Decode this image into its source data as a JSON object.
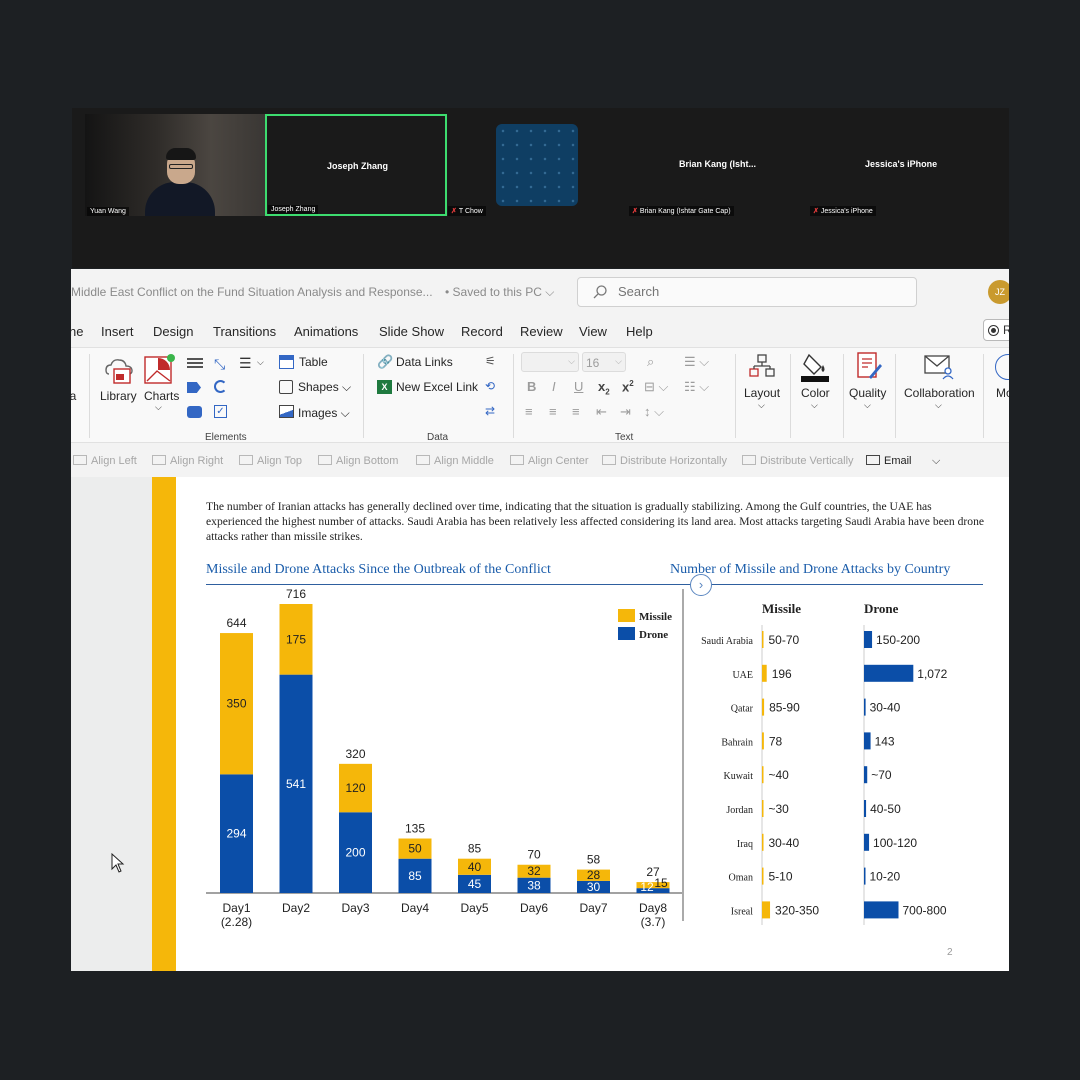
{
  "meeting": {
    "participants": [
      {
        "tile_name": "",
        "tag": "Yuan Wang",
        "muted": false
      },
      {
        "tile_name": "Joseph Zhang",
        "tag": "Joseph Zhang",
        "muted": false
      },
      {
        "tile_name": "",
        "tag": "T Chow",
        "muted": true
      },
      {
        "tile_name": "Brian Kang (Isht...",
        "tag": "Brian Kang (Ishtar Gate Cap)",
        "muted": true
      },
      {
        "tile_name": "Jessica's iPhone",
        "tag": "Jessica's iPhone",
        "muted": true
      }
    ]
  },
  "titlebar": {
    "doc_title": "e Middle East Conflict on the Fund Situation Analysis and Response...",
    "saved": "• Saved to this PC ⌵",
    "search_placeholder": "Search",
    "avatar_initials": "JZ"
  },
  "tabs": [
    "ne",
    "Insert",
    "Design",
    "Transitions",
    "Animations",
    "Slide Show",
    "Record",
    "Review",
    "View",
    "Help"
  ],
  "record_button": "R",
  "ribbon": {
    "cut_label": "la",
    "library": "Library",
    "charts": "Charts",
    "elements_group": "Elements",
    "table": "Table",
    "shapes": "Shapes ⌵",
    "images": "Images ⌵",
    "data_links": "Data Links",
    "new_excel_link": "New Excel Link",
    "data_group": "Data",
    "font_size": "16",
    "text_group": "Text",
    "layout": "Layout",
    "color": "Color",
    "quality": "Quality",
    "collaboration": "Collaboration",
    "more": "Mo"
  },
  "arrange_bar": [
    "Align Left",
    "Align Right",
    "Align Top",
    "Align Bottom",
    "Align Middle",
    "Align Center",
    "Distribute Horizontally",
    "Distribute Vertically"
  ],
  "email": "Email",
  "slide": {
    "intro": "The number of Iranian attacks has generally declined over time, indicating that the situation is gradually stabilizing. Among the Gulf countries, the UAE has experienced the highest number of attacks. Saudi Arabia has been relatively less affected considering its land area. Most attacks targeting Saudi Arabia have been drone attacks rather than missile strikes.",
    "left_title": "Missile and Drone Attacks Since the Outbreak of the Conflict",
    "right_title": "Number of Missile and Drone Attacks by Country",
    "nav_glyph": "›",
    "page_number": "2"
  },
  "colors": {
    "missile": "#f5b70a",
    "drone": "#0b4ea8",
    "accent": "#1a5caa"
  },
  "chart_data": [
    {
      "type": "bar",
      "stacked": true,
      "title": "Missile and Drone Attacks Since the Outbreak of the Conflict",
      "categories": [
        "Day1",
        "Day2",
        "Day3",
        "Day4",
        "Day5",
        "Day6",
        "Day7",
        "Day8"
      ],
      "category_sublabels": [
        "(2.28)",
        "",
        "",
        "",
        "",
        "",
        "",
        "(3.7)"
      ],
      "series": [
        {
          "name": "Drone",
          "values": [
            294,
            541,
            200,
            85,
            45,
            38,
            30,
            12
          ]
        },
        {
          "name": "Missile",
          "values": [
            350,
            175,
            120,
            50,
            40,
            32,
            28,
            15
          ]
        }
      ],
      "totals": [
        644,
        716,
        320,
        135,
        85,
        70,
        58,
        27
      ],
      "legend": "top-right",
      "legend_order": [
        "Missile",
        "Drone"
      ],
      "ylim": [
        0,
        716
      ]
    },
    {
      "type": "bar",
      "orientation": "horizontal",
      "title": "Number of Missile and Drone Attacks by Country",
      "categories": [
        "Saudi Arabia",
        "UAE",
        "Qatar",
        "Bahrain",
        "Kuwait",
        "Jordan",
        "Iraq",
        "Oman",
        "Isreal"
      ],
      "series": [
        {
          "name": "Missile",
          "labels": [
            "50-70",
            "196",
            "85-90",
            "78",
            "~40",
            "~30",
            "30-40",
            "5-10",
            "320-350"
          ],
          "values": [
            60,
            196,
            87,
            78,
            40,
            30,
            35,
            7,
            335
          ]
        },
        {
          "name": "Drone",
          "labels": [
            "150-200",
            "1,072",
            "30-40",
            "143",
            "~70",
            "40-50",
            "100-120",
            "10-20",
            "700-800"
          ],
          "values": [
            175,
            1072,
            35,
            143,
            70,
            45,
            110,
            15,
            750
          ]
        }
      ]
    }
  ]
}
